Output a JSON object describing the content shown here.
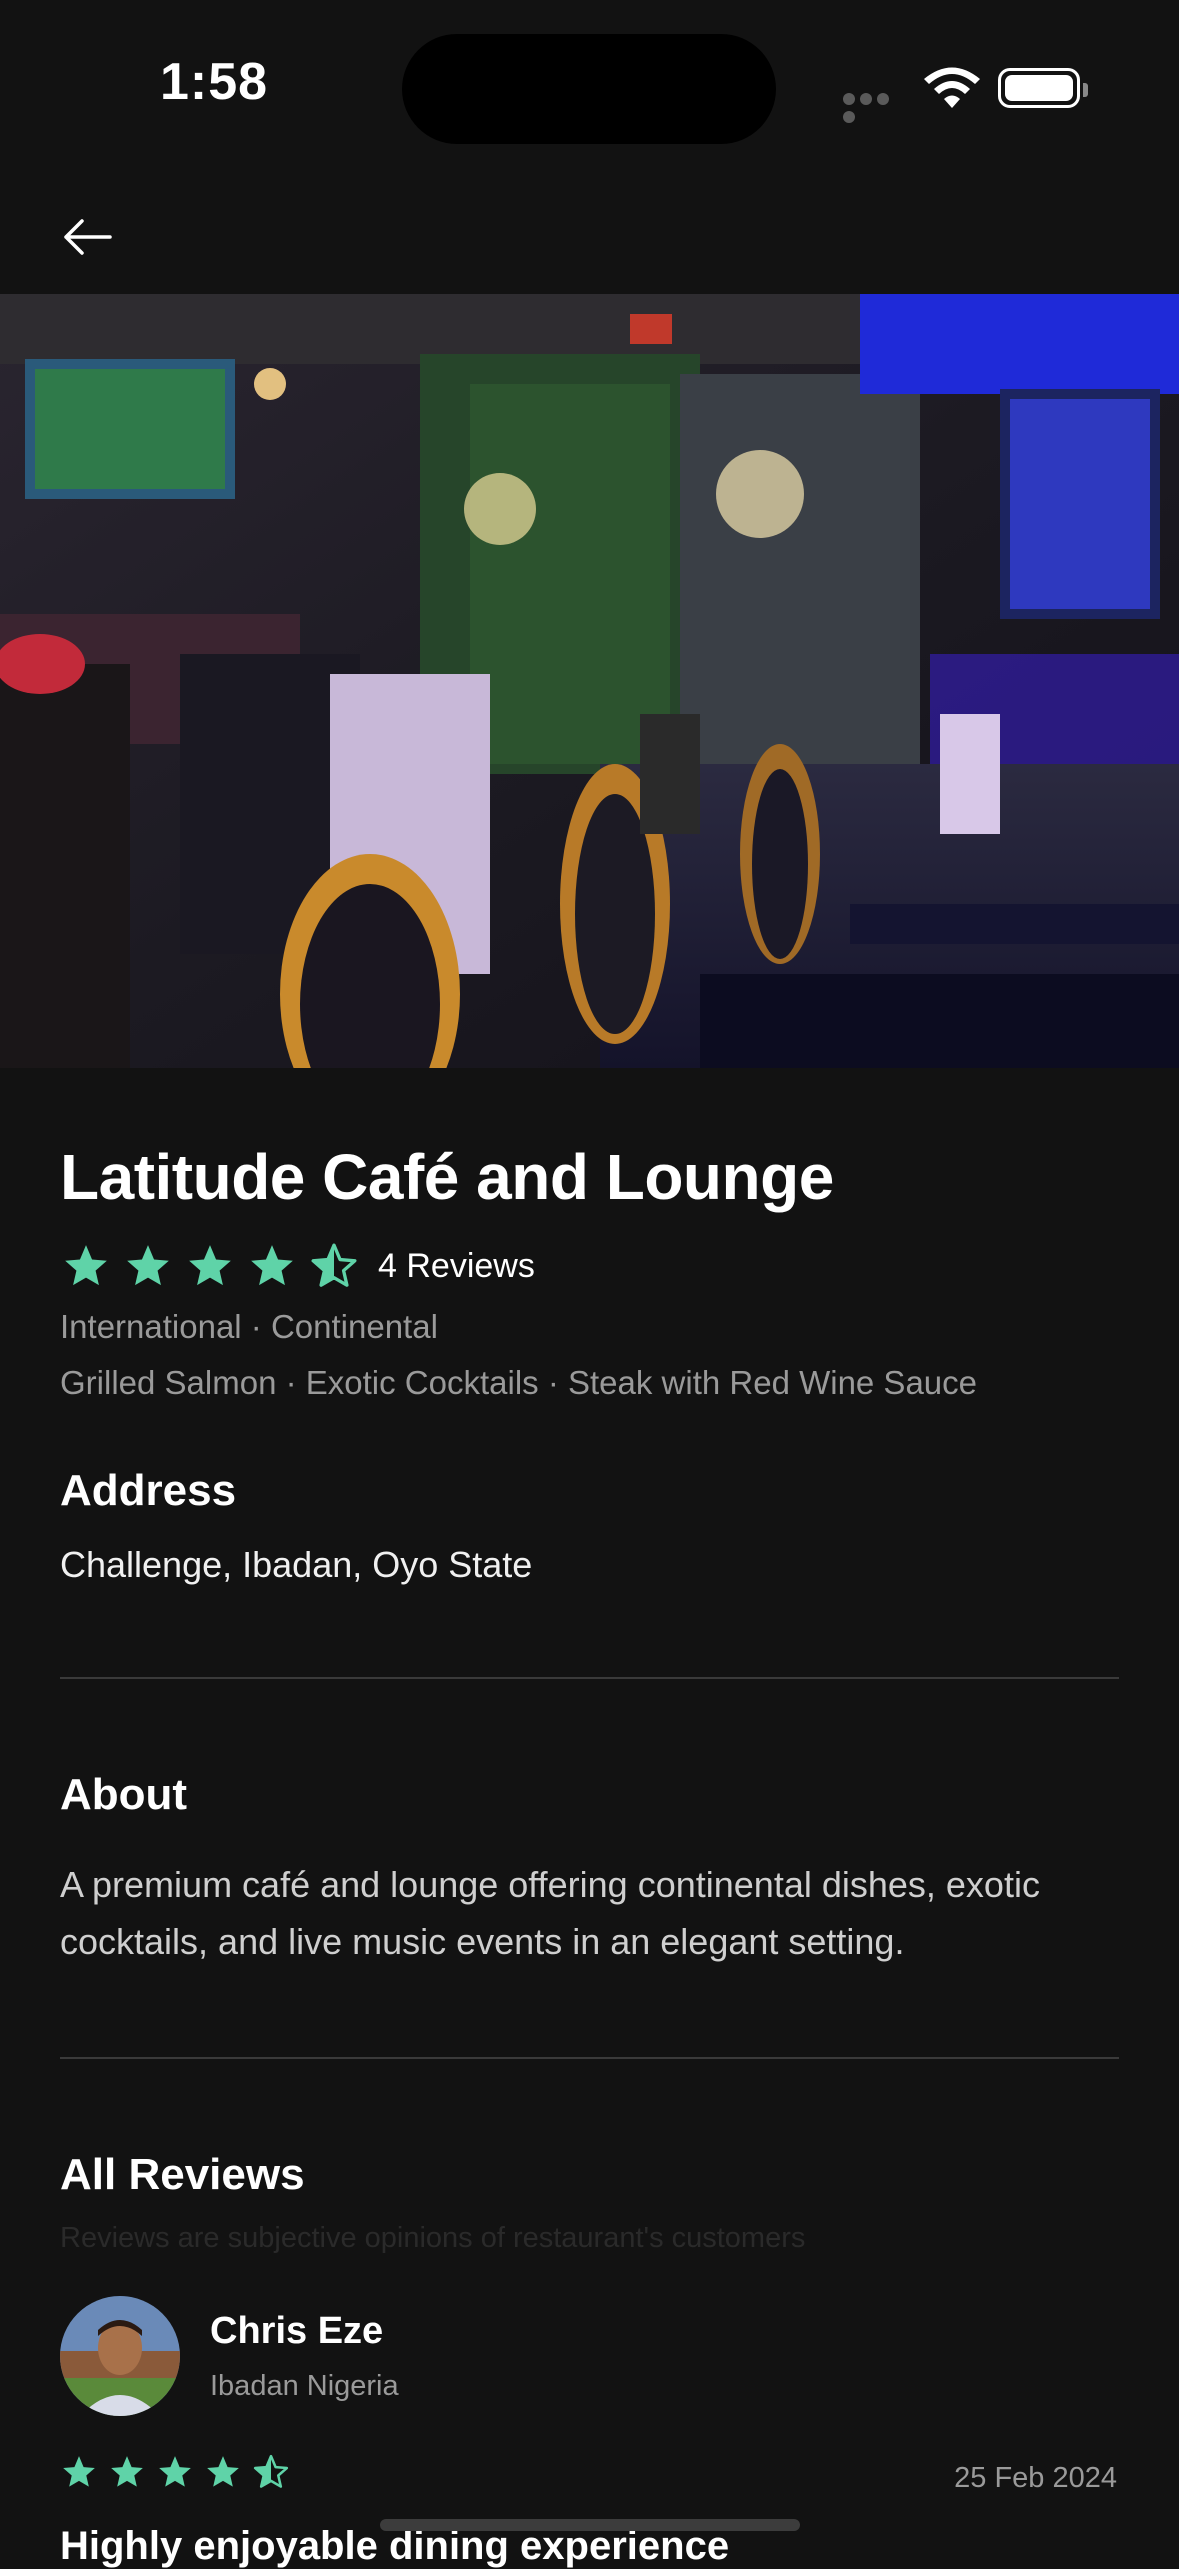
{
  "status_bar": {
    "time": "1:58"
  },
  "restaurant": {
    "name": "Latitude Café and Lounge",
    "rating": 4.5,
    "reviews_label": "4 Reviews",
    "cuisines": "International · Continental",
    "dishes": "Grilled Salmon · Exotic Cocktails · Steak with Red Wine Sauce"
  },
  "address": {
    "heading": "Address",
    "value": "Challenge, Ibadan, Oyo State"
  },
  "about": {
    "heading": "About",
    "text": "A premium café and lounge offering continental dishes, exotic cocktails, and live music events in an elegant setting."
  },
  "reviews": {
    "heading": "All Reviews",
    "subtitle": "Reviews are subjective opinions of restaurant's customers",
    "items": [
      {
        "name": "Chris Eze",
        "location": "Ibadan Nigeria",
        "rating": 4.5,
        "date": "25 Feb 2024",
        "title": "Highly enjoyable dining experience"
      }
    ]
  },
  "colors": {
    "accent": "#5fd3a8",
    "background": "#121212",
    "muted": "#9a9a9a"
  },
  "icons": [
    "back-arrow-icon",
    "wifi-icon",
    "battery-icon",
    "star-icon",
    "half-star-icon"
  ]
}
